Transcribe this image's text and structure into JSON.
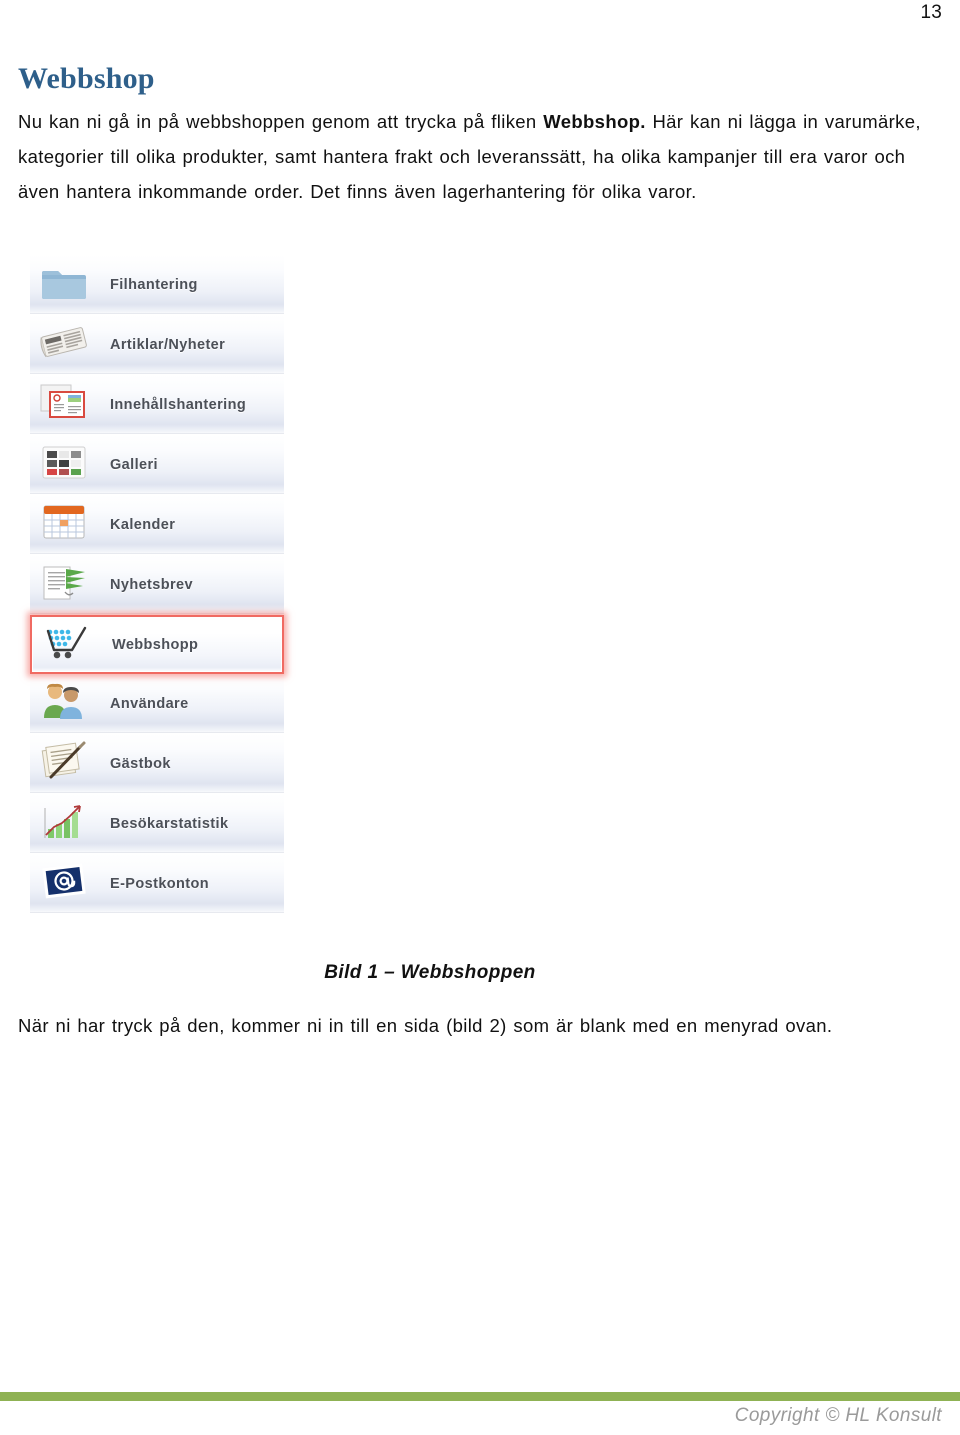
{
  "page": {
    "number": "13"
  },
  "heading": {
    "title": "Webbshop"
  },
  "intro": {
    "part1": "Nu kan ni gå in på webbshoppen genom att trycka på fliken ",
    "bold": "Webbshop.",
    "part2": " Här kan ni lägga in varumärke, kategorier till olika produkter, samt hantera frakt och leveranssätt, ha olika kampanjer till era varor och även hantera inkommande order. Det finns även lagerhantering för olika varor."
  },
  "figure": {
    "caption": "Bild 1 – Webbshoppen",
    "menu_items": [
      {
        "label": "Filhantering",
        "icon": "folder-icon",
        "selected": false
      },
      {
        "label": "Artiklar/Nyheter",
        "icon": "newspaper-icon",
        "selected": false
      },
      {
        "label": "Innehållshantering",
        "icon": "presentation-icon",
        "selected": false
      },
      {
        "label": "Galleri",
        "icon": "gallery-grid-icon",
        "selected": false
      },
      {
        "label": "Kalender",
        "icon": "calendar-icon",
        "selected": false
      },
      {
        "label": "Nyhetsbrev",
        "icon": "newsletter-icon",
        "selected": false
      },
      {
        "label": "Webbshopp",
        "icon": "shopping-cart-icon",
        "selected": true
      },
      {
        "label": "Användare",
        "icon": "users-icon",
        "selected": false
      },
      {
        "label": "Gästbok",
        "icon": "guestbook-pen-icon",
        "selected": false
      },
      {
        "label": "Besökarstatistik",
        "icon": "bar-chart-icon",
        "selected": false
      },
      {
        "label": "E-Postkonton",
        "icon": "email-stamp-icon",
        "selected": false
      }
    ]
  },
  "trailing": {
    "text": "När ni har tryck på den, kommer ni in till en sida (bild 2) som är blank med en menyrad ovan."
  },
  "footer": {
    "copyright": "Copyright © HL Konsult",
    "rule_color": "#8fb254"
  },
  "colors": {
    "heading": "#2e5f8a",
    "selection_border": "#f06a62",
    "footer_rule": "#8fb254",
    "copyright_text": "#9a9a9a"
  }
}
